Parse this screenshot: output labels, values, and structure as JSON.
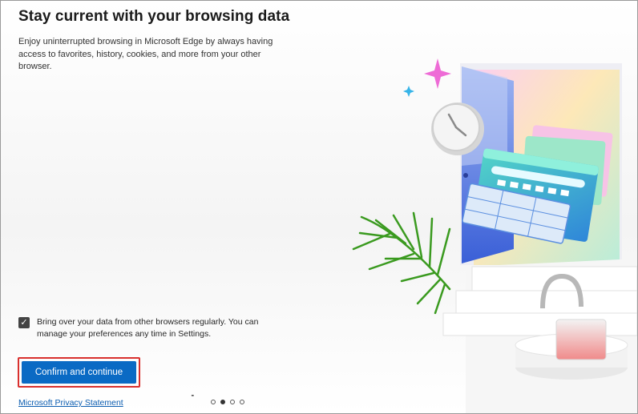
{
  "dialog": {
    "title": "Stay current with your browsing data",
    "description": "Enjoy uninterrupted browsing in Microsoft Edge by always having access to favorites, history, cookies, and more from your other browser."
  },
  "consent": {
    "checked": true,
    "check_icon": "checkmark-icon",
    "label": "Bring over your data from other browsers regularly. You can manage your preferences any time in Settings."
  },
  "actions": {
    "confirm_label": "Confirm and continue",
    "privacy_link": "Microsoft Privacy Statement"
  },
  "pager": {
    "total": 4,
    "current": 2
  },
  "colors": {
    "primary_button": "#0a6ac4",
    "focus_outline": "#d9302e",
    "link": "#0a5cb0"
  }
}
